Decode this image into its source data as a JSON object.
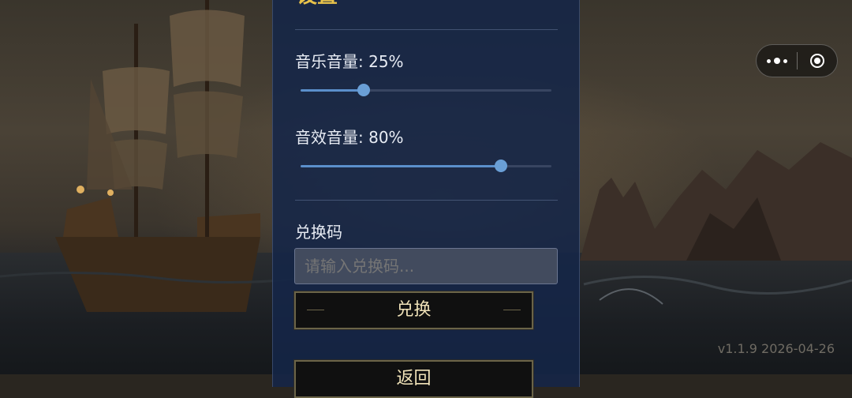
{
  "background": {
    "ghost_title": "",
    "version_text": "v1.1.9  2026-04-26"
  },
  "capsule": {
    "more_icon": "more-dots-icon",
    "close_icon": "target-close-icon"
  },
  "settings": {
    "title": "设置",
    "music_volume": {
      "label": "音乐音量: 25%",
      "value": 25
    },
    "sfx_volume": {
      "label": "音效音量: 80%",
      "value": 80
    },
    "redeem": {
      "label": "兑换码",
      "placeholder": "请输入兑换码...",
      "button_label": "兑换"
    },
    "back_button_label": "返回"
  },
  "colors": {
    "panel": "#142648",
    "accent_title": "#e8c24a",
    "slider": "#5b8fcb",
    "button_border": "#6b6448"
  }
}
